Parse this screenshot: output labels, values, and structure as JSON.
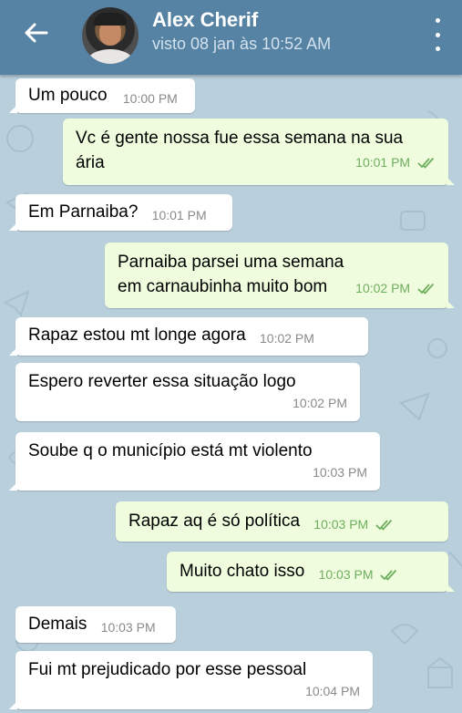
{
  "header": {
    "contact_name": "Alex Cherif",
    "status": "visto 08 jan às 10:52 AM",
    "back_icon": "arrow-left-icon",
    "menu_icon": "more-vertical-icon",
    "background": "#5682a3"
  },
  "chat": {
    "background": "#b9cfdc",
    "incoming_color": "#ffffff",
    "outgoing_color": "#effdde",
    "check_color": "#6fad5f",
    "messages": [
      {
        "dir": "in",
        "text": "Um pouco",
        "time": "10:00 PM"
      },
      {
        "dir": "out",
        "text": "Vc é  gente nossa fue essa semana na sua ária",
        "time": "10:01 PM",
        "read": true
      },
      {
        "dir": "in",
        "text": "Em Parnaiba?",
        "time": "10:01 PM"
      },
      {
        "dir": "out",
        "text": "Parnaiba parsei uma semana em carnaubinha muito bom",
        "time": "10:02 PM",
        "read": true
      },
      {
        "dir": "in",
        "text": "Rapaz estou mt longe agora",
        "time": "10:02 PM"
      },
      {
        "dir": "in",
        "text": "Espero reverter essa situação logo",
        "time": "10:02 PM"
      },
      {
        "dir": "in",
        "text": "Soube q o município está mt violento",
        "time": "10:03 PM"
      },
      {
        "dir": "out",
        "text": "Rapaz aq é  só  política",
        "time": "10:03 PM",
        "read": true
      },
      {
        "dir": "out",
        "text": "Muito  chato isso",
        "time": "10:03 PM",
        "read": true
      },
      {
        "dir": "in",
        "text": "Demais",
        "time": "10:03 PM"
      },
      {
        "dir": "in",
        "text": "Fui mt prejudicado por esse pessoal",
        "time": "10:04 PM"
      }
    ]
  }
}
